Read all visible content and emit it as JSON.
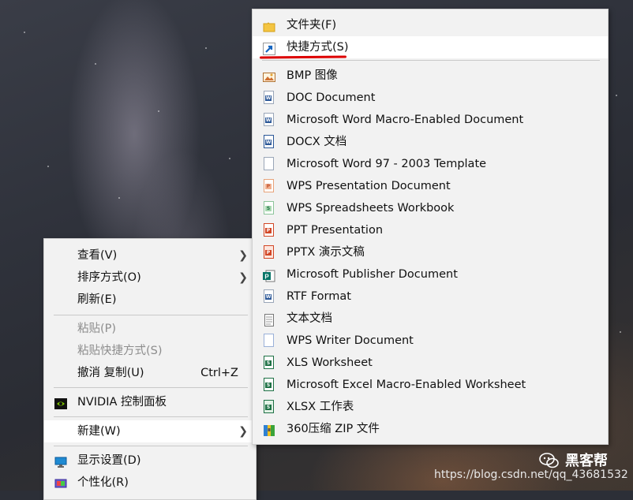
{
  "context_menu": {
    "items": [
      {
        "label": "查看(V)"
      },
      {
        "label": "排序方式(O)"
      },
      {
        "label": "刷新(E)"
      },
      {
        "label": "粘贴(P)"
      },
      {
        "label": "粘贴快捷方式(S)"
      },
      {
        "label": "撤消 复制(U)",
        "shortcut": "Ctrl+Z"
      },
      {
        "label": "NVIDIA 控制面板"
      },
      {
        "label": "新建(W)"
      },
      {
        "label": "显示设置(D)"
      },
      {
        "label": "个性化(R)"
      }
    ]
  },
  "new_submenu": {
    "items": [
      {
        "label": "文件夹(F)",
        "icon": "folder-icon"
      },
      {
        "label": "快捷方式(S)",
        "icon": "shortcut-icon"
      },
      {
        "label": "BMP 图像",
        "icon": "bmp-image-icon"
      },
      {
        "label": "DOC Document",
        "icon": "word-doc-icon"
      },
      {
        "label": "Microsoft Word Macro-Enabled Document",
        "icon": "word-doc-icon"
      },
      {
        "label": "DOCX 文档",
        "icon": "word-docx-icon"
      },
      {
        "label": "Microsoft Word 97 - 2003 Template",
        "icon": "blank-doc-icon"
      },
      {
        "label": "WPS Presentation Document",
        "icon": "wps-presentation-icon"
      },
      {
        "label": "WPS Spreadsheets Workbook",
        "icon": "wps-spreadsheet-icon"
      },
      {
        "label": "PPT Presentation",
        "icon": "ppt-icon"
      },
      {
        "label": "PPTX 演示文稿",
        "icon": "pptx-icon"
      },
      {
        "label": "Microsoft Publisher Document",
        "icon": "publisher-icon"
      },
      {
        "label": "RTF Format",
        "icon": "rtf-icon"
      },
      {
        "label": "文本文档",
        "icon": "text-doc-icon"
      },
      {
        "label": "WPS Writer Document",
        "icon": "wps-writer-icon"
      },
      {
        "label": "XLS Worksheet",
        "icon": "xls-icon"
      },
      {
        "label": "Microsoft Excel Macro-Enabled Worksheet",
        "icon": "excel-macro-icon"
      },
      {
        "label": "XLSX 工作表",
        "icon": "xlsx-icon"
      },
      {
        "label": "360压缩 ZIP 文件",
        "icon": "zip-archive-icon"
      }
    ]
  },
  "watermark": {
    "brand": "黑客帮",
    "url": "https://blog.csdn.net/qq_43681532"
  },
  "colors": {
    "menu_bg": "#f2f2f2",
    "highlight": "#ffffff",
    "annotation_red": "#dd0000",
    "word_blue": "#2b5797",
    "excel_green": "#1e7145",
    "ppt_orange": "#d24726"
  }
}
